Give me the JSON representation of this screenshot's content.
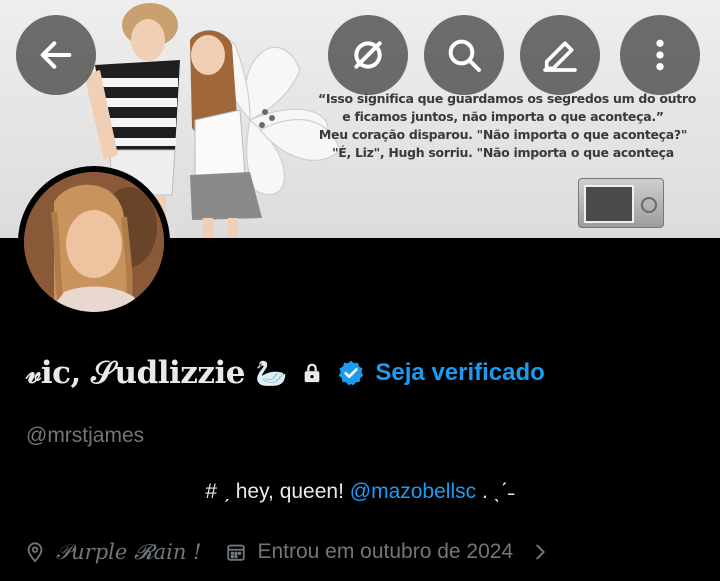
{
  "banner": {
    "quote_lines": [
      "“Isso significa que guardamos os segredos um do outro",
      "e ficamos juntos, não importa o que aconteça.”",
      "Meu coração disparou. \"Não importa o que aconteça?\"",
      "\"É, Liz\", Hugh sorriu. \"Não importa o que aconteça"
    ]
  },
  "toolbar": {
    "back_icon": "arrow-left-icon",
    "grok_icon": "grok-icon",
    "search_icon": "search-icon",
    "compose_icon": "edit-icon",
    "more_icon": "more-vertical-icon"
  },
  "profile": {
    "display_name": "𝓋ic, 𝒮udlizzie",
    "name_emoji": "🦢",
    "verify_cta": "Seja verificado",
    "handle": "@mrstjames",
    "bio_prefix": "# ˏ hey, queen! ",
    "bio_mention": "@mazobellsc",
    "bio_suffix": " . ˎˊ˗",
    "location": "𝒫urple 𝓡ain !",
    "joined": "Entrou em outubro de 2024"
  },
  "colors": {
    "accent": "#1d9bf0",
    "secondary_text": "#71767b",
    "background": "#000000"
  }
}
